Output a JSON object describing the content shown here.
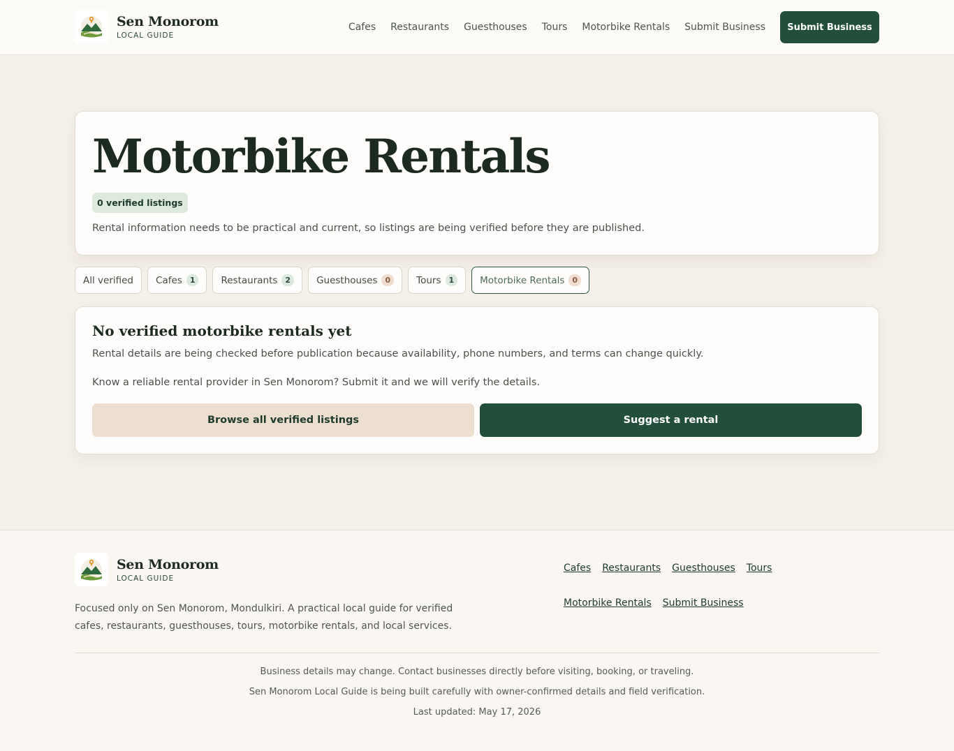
{
  "header": {
    "brand_name": "Sen Monorom",
    "brand_sub": "LOCAL GUIDE",
    "nav": [
      "Cafes",
      "Restaurants",
      "Guesthouses",
      "Tours",
      "Motorbike Rentals",
      "Submit Business"
    ],
    "cta": "Submit Business"
  },
  "hero": {
    "title": "Motorbike Rentals",
    "badge": "0 verified listings",
    "description": "Rental information needs to be practical and current, so listings are being verified before they are published."
  },
  "tabs": [
    {
      "label": "All verified",
      "count": null
    },
    {
      "label": "Cafes",
      "count": "1"
    },
    {
      "label": "Restaurants",
      "count": "2"
    },
    {
      "label": "Guesthouses",
      "count": "0"
    },
    {
      "label": "Tours",
      "count": "1"
    },
    {
      "label": "Motorbike Rentals",
      "count": "0"
    }
  ],
  "empty_state": {
    "title": "No verified motorbike rentals yet",
    "text1": "Rental details are being checked before publication because availability, phone numbers, and terms can change quickly.",
    "text2": "Know a reliable rental provider in Sen Monorom? Submit it and we will verify the details.",
    "browse_button": "Browse all verified listings",
    "suggest_button": "Suggest a rental"
  },
  "footer": {
    "brand_name": "Sen Monorom",
    "brand_sub": "LOCAL GUIDE",
    "description": "Focused only on Sen Monorom, Mondulkiri. A practical local guide for verified cafes, restaurants, guesthouses, tours, motorbike rentals, and local services.",
    "links": [
      "Cafes",
      "Restaurants",
      "Guesthouses",
      "Tours",
      "Motorbike Rentals",
      "Submit Business"
    ],
    "note1": "Business details may change. Contact businesses directly before visiting, booking, or traveling.",
    "note2": "Sen Monorom Local Guide is being built carefully with owner-confirmed details and field verification.",
    "updated": "Last updated: May 17, 2026"
  },
  "colors": {
    "brand_green": "#234e3b",
    "page_bg": "#f5f0ea",
    "card_bg": "#fefdfb",
    "badge_green": "#dfeadf",
    "count_tan": "#f1ddd0"
  }
}
